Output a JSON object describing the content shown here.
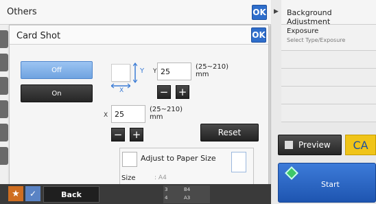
{
  "others": {
    "title": "Others",
    "ok_label": "OK"
  },
  "card_shot": {
    "title": "Card Shot",
    "ok_label": "OK",
    "off_label": "Off",
    "on_label": "On",
    "y_axis_label": "Y",
    "x_axis_label": "X",
    "y_value": "25",
    "x_value": "25",
    "range_text": "(25~210)",
    "unit": "mm",
    "minus_label": "−",
    "plus_label": "+",
    "reset_label": "Reset",
    "adjust_label": "Adjust to Paper Size",
    "size_label": "Size",
    "size_value": "A4"
  },
  "bottom": {
    "back_label": "Back",
    "tray_labels": [
      "B4",
      "A3"
    ],
    "tray_numbers": [
      "3",
      "4"
    ]
  },
  "right_panel": {
    "header": "Background Adjustment",
    "exposure_title": "Exposure",
    "exposure_sub": "Select Type/Exposure",
    "preview_label": "Preview",
    "ca_label": "CA",
    "start_label": "Start"
  },
  "colors": {
    "accent": "#2f6ecb",
    "start": "#1e55b0",
    "ca": "#f0c419",
    "selected": "#6fa3e0"
  }
}
